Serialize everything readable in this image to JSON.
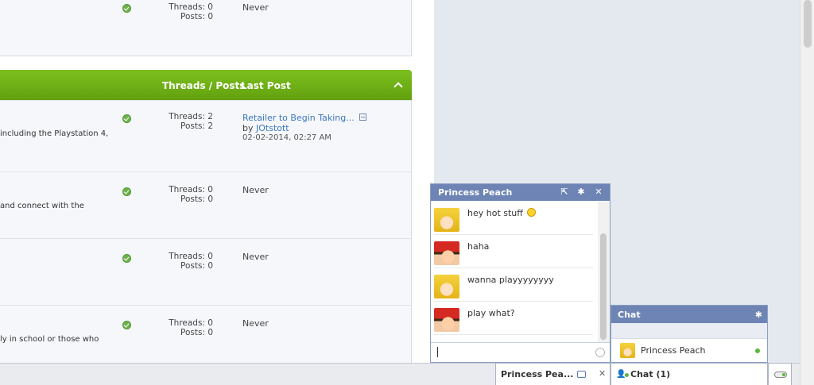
{
  "forum": {
    "top_row": {
      "threads": "Threads: 0",
      "posts": "Posts: 0",
      "last_post": "Never"
    },
    "category_header": {
      "threads_posts": "Threads / Posts",
      "last_post": "Last Post"
    },
    "rows": [
      {
        "desc": "including the Playstation 4,",
        "threads": "Threads: 2",
        "posts": "Posts: 2",
        "last_post_title": "Retailer to Begin Taking...",
        "by": "by",
        "author": "JOtstott",
        "date": "02-02-2014, 02:27 AM"
      },
      {
        "desc": "and connect with the",
        "threads": "Threads: 0",
        "posts": "Posts: 0",
        "last_post": "Never"
      },
      {
        "desc": "",
        "threads": "Threads: 0",
        "posts": "Posts: 0",
        "last_post": "Never"
      },
      {
        "desc": "ly in school or those who",
        "threads": "Threads: 0",
        "posts": "Posts: 0",
        "last_post": "Never"
      }
    ]
  },
  "chat_window": {
    "title": "Princess Peach",
    "messages": [
      {
        "sender_avatar": "peach-avatar",
        "text": "hey hot stuff"
      },
      {
        "sender_avatar": "mario-avatar",
        "text": "haha"
      },
      {
        "sender_avatar": "peach-avatar",
        "text": "wanna playyyyyyyy"
      },
      {
        "sender_avatar": "mario-avatar",
        "text": "play what?"
      }
    ],
    "input_value": ""
  },
  "buddy_list": {
    "title": "Chat",
    "buddies": [
      {
        "name": "Princess Peach",
        "status": "online"
      }
    ]
  },
  "bottom_bar": {
    "chat_tab_user": "Princess Pea...",
    "chat_tab_label": "Chat",
    "chat_tab_count": "(1)"
  },
  "colors": {
    "accent_green": "#6fb01a",
    "chat_blue": "#6d84b4",
    "link": "#3a78c0",
    "online": "#58b83b"
  }
}
